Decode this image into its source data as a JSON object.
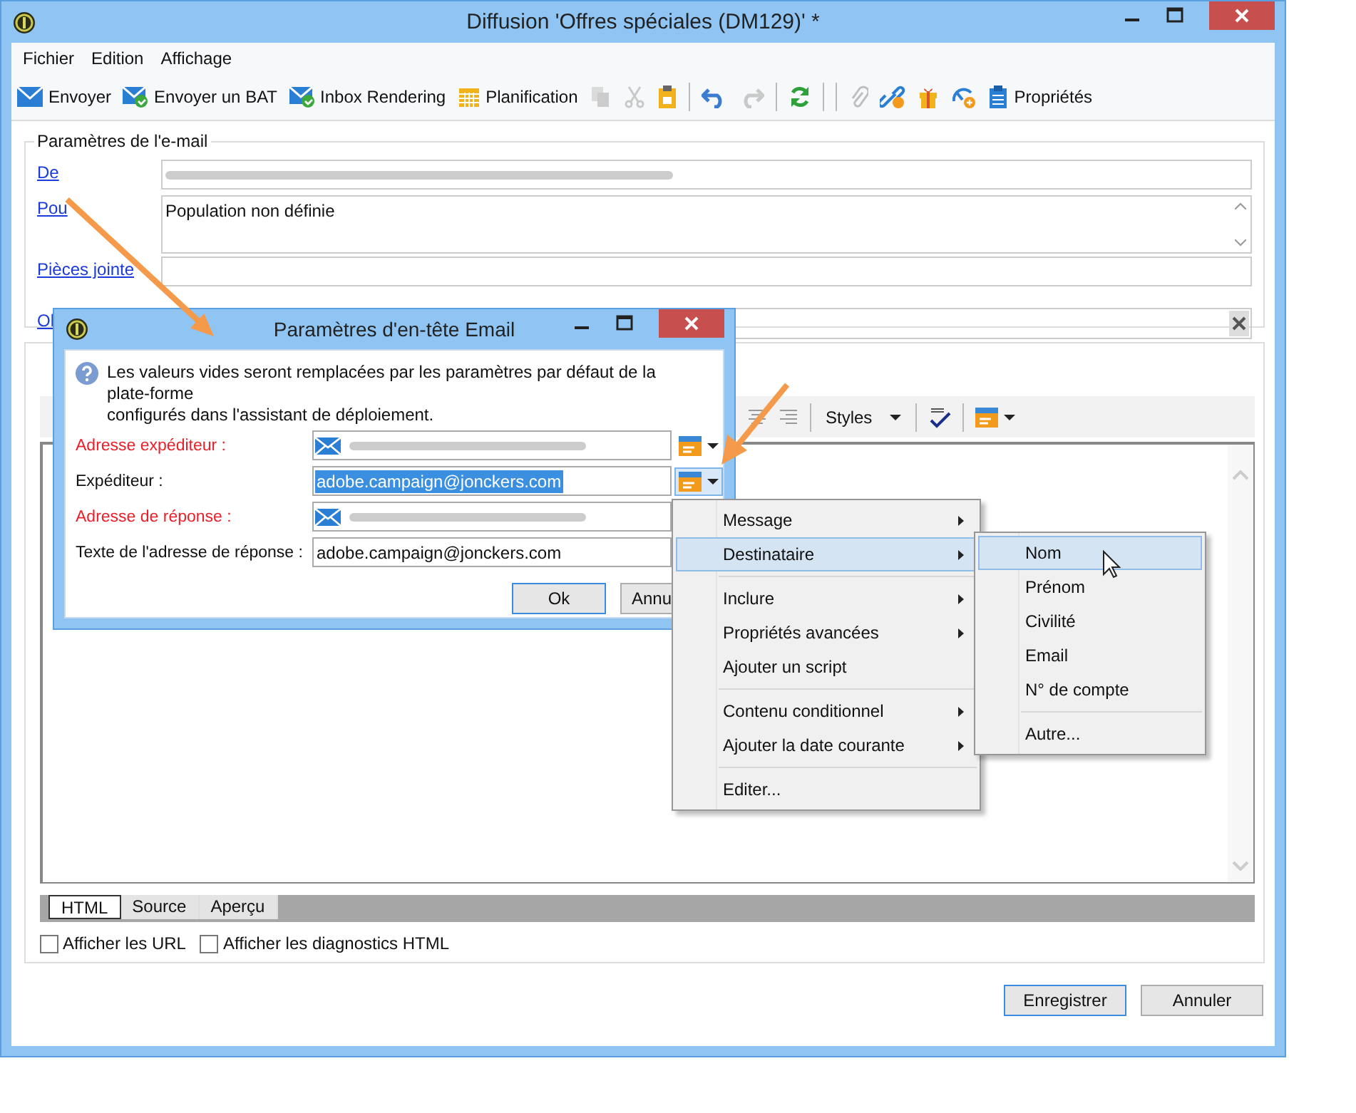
{
  "window": {
    "title": "Diffusion 'Offres spéciales (DM129)' *"
  },
  "menu": [
    "Fichier",
    "Edition",
    "Affichage"
  ],
  "toolbar": [
    {
      "kind": "send",
      "label": "Envoyer",
      "disabled": false
    },
    {
      "kind": "bat",
      "label": "Envoyer un BAT",
      "disabled": false
    },
    {
      "kind": "inbox",
      "label": "Inbox Rendering",
      "disabled": false
    },
    {
      "kind": "calendar",
      "label": "Planification",
      "disabled": false
    },
    {
      "kind": "copy",
      "disabled": true
    },
    {
      "kind": "cut",
      "disabled": true
    },
    {
      "kind": "paste",
      "disabled": false
    },
    {
      "kind": "separator"
    },
    {
      "kind": "undo",
      "disabled": false
    },
    {
      "kind": "redo",
      "disabled": true
    },
    {
      "kind": "separator"
    },
    {
      "kind": "refresh",
      "disabled": false
    },
    {
      "kind": "separator"
    },
    {
      "kind": "separator"
    },
    {
      "kind": "attach",
      "disabled": true
    },
    {
      "kind": "link",
      "disabled": false
    },
    {
      "kind": "gift",
      "disabled": false
    },
    {
      "kind": "tracking",
      "disabled": false
    },
    {
      "kind": "properties",
      "label": "Propriétés",
      "disabled": false
    }
  ],
  "email_params": {
    "title": "Paramètres de l'e-mail",
    "fields": [
      {
        "label": "De",
        "kind": "redacted"
      },
      {
        "label": "Pou",
        "kind": "multiline",
        "value": "Population non définie"
      },
      {
        "label": "Pièces jointe",
        "kind": "line"
      },
      {
        "label": "Ol",
        "kind": "clear"
      }
    ]
  },
  "editor": {
    "toolbar": [
      {
        "kind": "align-center"
      },
      {
        "kind": "align-right"
      },
      {
        "kind": "separator"
      },
      {
        "kind": "styles",
        "label": "Styles"
      },
      {
        "kind": "separator"
      },
      {
        "kind": "spellcheck"
      },
      {
        "kind": "separator"
      },
      {
        "kind": "insert"
      }
    ],
    "tabs": [
      {
        "label": "HTML",
        "selected": true
      },
      {
        "label": "Source",
        "selected": false
      },
      {
        "label": "Aperçu",
        "selected": false
      }
    ],
    "options": [
      {
        "label": "Afficher les URL",
        "checked": false
      },
      {
        "label": "Afficher les diagnostics HTML",
        "checked": false
      }
    ]
  },
  "buttons": [
    {
      "label": "Enregistrer",
      "default": true
    },
    {
      "label": "Annuler",
      "default": false
    }
  ],
  "dialog": {
    "title": "Paramètres d'en-tête Email",
    "info": "Les valeurs vides seront remplacées par les paramètres par défaut de la plate-forme\nconfigurés dans l'assistant de déploiement.",
    "fields": [
      {
        "label": "Adresse expéditeur :",
        "required": true,
        "kind": "redacted",
        "picker": {
          "active": false
        }
      },
      {
        "label": "Expéditeur :",
        "required": false,
        "kind": "text",
        "value": "adobe.campaign@jonckers.com",
        "highlighted": true,
        "picker": {
          "active": true
        }
      },
      {
        "label": "Adresse de réponse :",
        "required": true,
        "kind": "redacted"
      },
      {
        "label": "Texte de l'adresse de réponse :",
        "required": false,
        "kind": "text",
        "value": "adobe.campaign@jonckers.com",
        "highlighted": false
      }
    ],
    "buttons": [
      {
        "label": "Ok",
        "default": true
      },
      {
        "label": "Annu",
        "default": false
      }
    ]
  },
  "popup": {
    "groups": [
      [
        {
          "label": "Message",
          "submenu": true,
          "selected": false
        },
        {
          "label": "Destinataire",
          "submenu": true,
          "selected": true
        }
      ],
      [
        {
          "label": "Inclure",
          "submenu": true,
          "selected": false
        },
        {
          "label": "Propriétés avancées",
          "submenu": true,
          "selected": false
        },
        {
          "label": "Ajouter un script",
          "submenu": false,
          "selected": false
        }
      ],
      [
        {
          "label": "Contenu conditionnel",
          "submenu": true,
          "selected": false
        },
        {
          "label": "Ajouter la date courante",
          "submenu": true,
          "selected": false
        }
      ],
      [
        {
          "label": "Editer...",
          "submenu": false,
          "selected": false
        }
      ]
    ]
  },
  "submenu": {
    "groups": [
      [
        {
          "label": "Nom",
          "selected": true
        },
        {
          "label": "Prénom",
          "selected": false
        },
        {
          "label": "Civilité",
          "selected": false
        },
        {
          "label": "Email",
          "selected": false
        },
        {
          "label": "N° de compte",
          "selected": false
        }
      ],
      [
        {
          "label": "Autre...",
          "selected": false
        }
      ]
    ]
  }
}
